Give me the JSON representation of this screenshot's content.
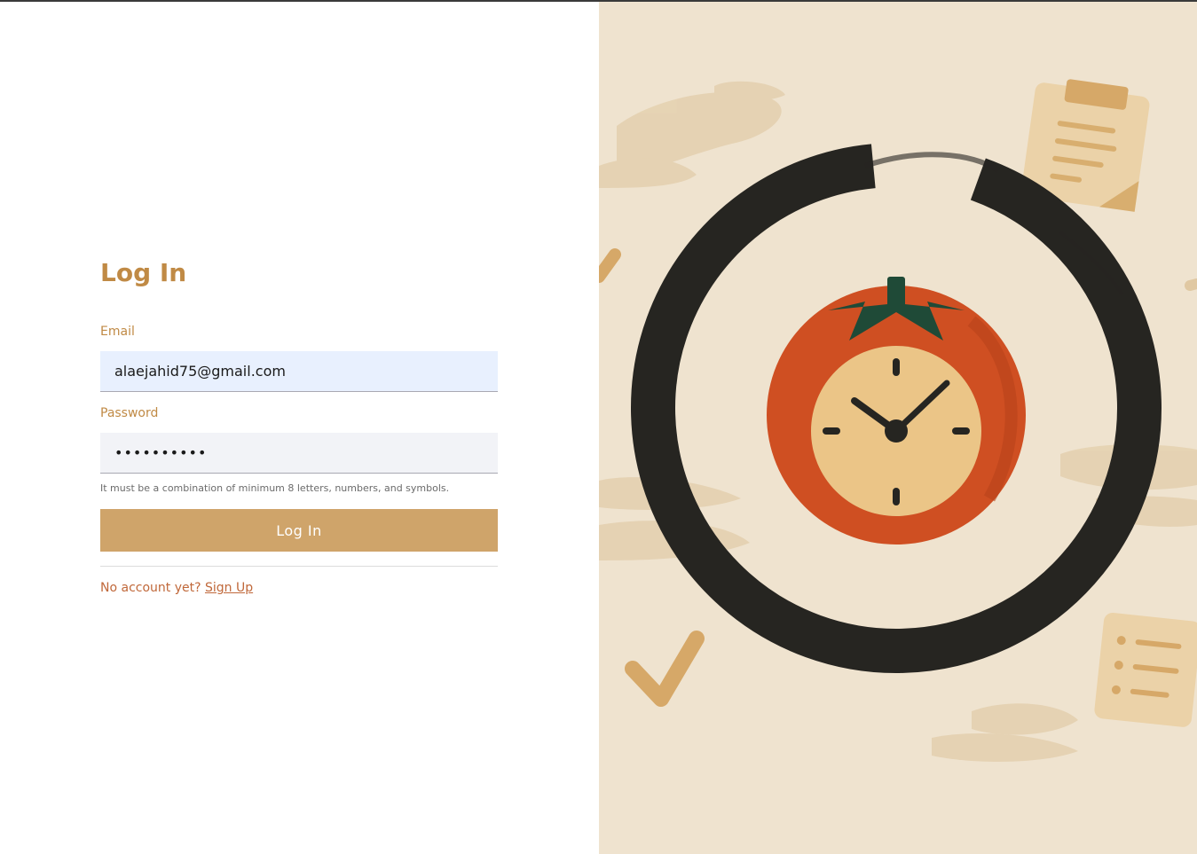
{
  "login": {
    "title": "Log In",
    "email_label": "Email",
    "email_value": "alaejahid75@gmail.com",
    "password_label": "Password",
    "password_value": "••••••••••",
    "password_hint": "It must be a combination of minimum 8 letters, numbers, and symbols.",
    "submit_label": "Log In",
    "no_account_text": "No account yet?",
    "signup_link": "Sign Up"
  },
  "colors": {
    "accent": "#c08a45",
    "button": "#cfa46a",
    "link": "#c0683a",
    "illustration_bg": "#efe3cf",
    "tomato": "#cf4f22",
    "clock_face": "#ebc587",
    "brush_ring": "#262521"
  },
  "illustration": {
    "icons": [
      "tomato-clock-icon",
      "brush-circle",
      "checklist-note-icon",
      "checkmark-icon",
      "note-paper-icon"
    ]
  }
}
